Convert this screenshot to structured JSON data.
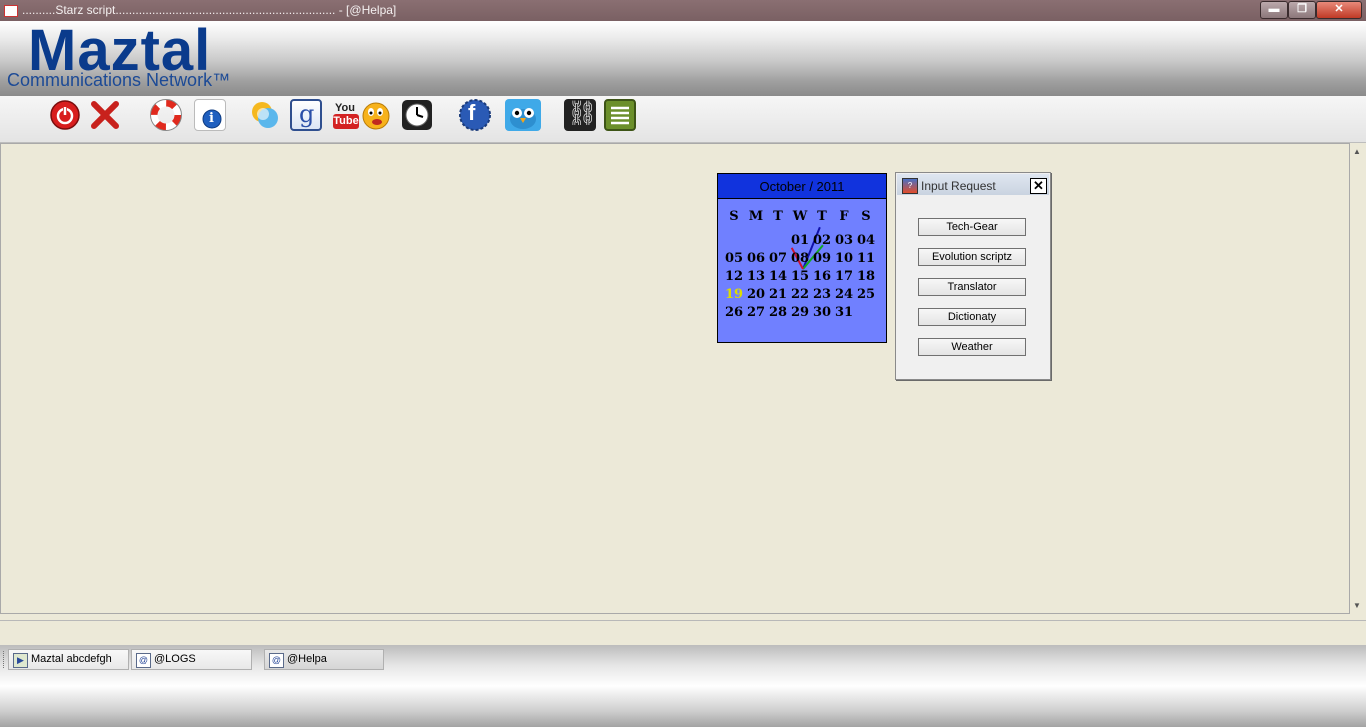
{
  "window": {
    "title": "..........Starz script.................................................................. - [@Helpa]",
    "min_glyph": "▬",
    "max_glyph": "❐",
    "close_glyph": "✕"
  },
  "banner": {
    "logo_main": "Maztal",
    "logo_sub": "Communications Network™"
  },
  "toolbar": {
    "icons": [
      "power-icon",
      "close-x-icon",
      "lifebuoy-icon",
      "info-icon",
      "chat-bubble-icon",
      "google-icon",
      "youtube-icon",
      "emoticon-icon",
      "clock-icon",
      "facebook-icon",
      "twitter-bird-icon",
      "link-chain-icon",
      "list-icon"
    ],
    "google_glyph": "g",
    "youtube_top": "You",
    "youtube_bottom": "Tube",
    "facebook_glyph": "f",
    "info_glyph": "i",
    "chain_glyph": "⛓"
  },
  "calendar": {
    "header": "October / 2011",
    "weekdays": [
      "S",
      "M",
      "T",
      "W",
      "T",
      "F",
      "S"
    ],
    "weeks": [
      [
        "",
        "",
        "",
        "",
        "01",
        "02",
        "03",
        "04"
      ],
      [
        "05",
        "06",
        "07",
        "08",
        "09",
        "10",
        "11"
      ],
      [
        "12",
        "13",
        "14",
        "15",
        "16",
        "17",
        "18"
      ],
      [
        "19",
        "20",
        "21",
        "22",
        "23",
        "24",
        "25"
      ],
      [
        "26",
        "27",
        "28",
        "29",
        "30",
        "31",
        ""
      ]
    ],
    "today": "19"
  },
  "dialog": {
    "title": "Input Request",
    "close_glyph": "✕",
    "icon_glyph": "?",
    "buttons": [
      "Tech-Gear",
      "Evolution scriptz",
      "Translator",
      "Dictionaty",
      "Weather"
    ]
  },
  "taskbar": {
    "items": [
      {
        "label": "Maztal abcdefgh",
        "icon": "app-icon"
      },
      {
        "label": "@LOGS",
        "icon": "at-window-icon"
      },
      {
        "label": "@Helpa",
        "icon": "at-window-icon"
      }
    ],
    "at_glyph": "@"
  },
  "colors": {
    "titlebar": "#7a6063",
    "calendar_bg": "#7080ff",
    "calendar_header": "#1133dd",
    "logo": "#0a3b8c",
    "workspace": "#ece9d8"
  }
}
